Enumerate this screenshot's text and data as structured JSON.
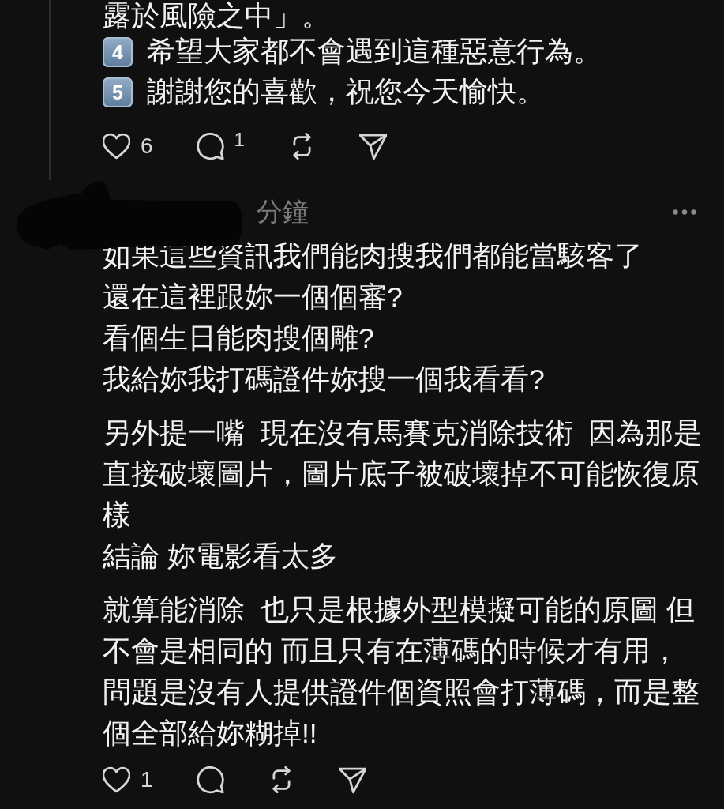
{
  "thread_post": {
    "continued_text": "露於風險之中」。",
    "items": [
      {
        "number": "4",
        "text": "希望大家都不會遇到這種惡意行為。"
      },
      {
        "number": "5",
        "text": "謝謝您的喜歡，祝您今天愉快。"
      }
    ],
    "actions": [
      {
        "kind": "like",
        "count": "6"
      },
      {
        "kind": "reply",
        "count": "1"
      },
      {
        "kind": "repost"
      },
      {
        "kind": "share"
      }
    ]
  },
  "reply": {
    "author_redacted": true,
    "time": "分鐘",
    "paragraphs": [
      {
        "lines": [
          "如果這些資訊我們能肉搜我們都能當駭客了",
          "還在這裡跟妳一個個審?",
          "看個生日能肉搜個雕?",
          "我給妳我打碼證件妳搜一個我看看?"
        ]
      },
      {
        "lines": [
          "另外提一嘴  現在沒有馬賽克消除技術  因為那是直接破壞圖片，圖片底子被破壞掉不可能恢復原樣",
          "結論 妳電影看太多"
        ]
      },
      {
        "lines": [
          "就算能消除  也只是根據外型模擬可能的原圖 但不會是相同的 而且只有在薄碼的時候才有用，",
          "問題是沒有人提供證件個資照會打薄碼，而是整個全部給妳糊掉!!"
        ]
      }
    ],
    "actions": [
      {
        "kind": "like",
        "count": "1"
      },
      {
        "kind": "reply"
      },
      {
        "kind": "repost"
      },
      {
        "kind": "share"
      }
    ]
  }
}
